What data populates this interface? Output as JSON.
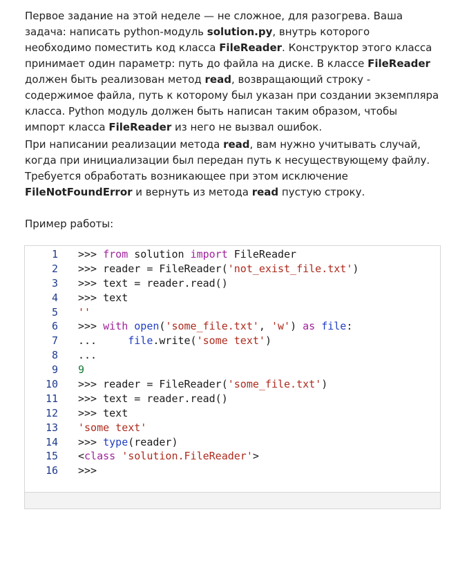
{
  "paragraph1": {
    "t1": "Первое задание на этой неделе — не сложное, для разогрева. Ваша задача: написать python-модуль ",
    "b1": "solution.py",
    "t2": ", внутрь которого необходимо поместить код класса ",
    "b2": "FileReader",
    "t3": ". Конструктор этого класса принимает один параметр: путь до файла на диске. В классе ",
    "b3": "FileReader",
    "t4": " должен быть реализован метод ",
    "b4": "read",
    "t5": ", возвращающий строку - содержимое файла, путь к которому был указан при создании экземпляра класса. Python модуль должен быть написан таким образом, чтобы импорт класса ",
    "b5": "FileReader",
    "t6": " из него не вызвал ошибок."
  },
  "paragraph2": {
    "t1": "При написании реализации метода ",
    "b1": "read",
    "t2": ", вам нужно учитывать случай, когда при инициализации был передан путь к несуществующему файлу. Требуется обработать возникающее при этом исключение ",
    "b2": "FileNotFoundError",
    "t3": " и вернуть из метода ",
    "b3": "read",
    "t4": " пустую строку."
  },
  "paragraph3": {
    "text": "Пример работы:"
  },
  "code_example": {
    "line_numbers": [
      "1",
      "2",
      "3",
      "4",
      "5",
      "6",
      "7",
      "8",
      "9",
      "10",
      "11",
      "12",
      "13",
      "14",
      "15",
      "16"
    ],
    "lines": [
      [
        {
          "t": ">>> "
        },
        {
          "t": "from",
          "c": "kw"
        },
        {
          "t": " solution "
        },
        {
          "t": "import",
          "c": "kw"
        },
        {
          "t": " FileReader"
        }
      ],
      [
        {
          "t": ">>> reader = FileReader("
        },
        {
          "t": "'not_exist_file.txt'",
          "c": "str"
        },
        {
          "t": ")"
        }
      ],
      [
        {
          "t": ">>> text = reader.read()"
        }
      ],
      [
        {
          "t": ">>> text"
        }
      ],
      [
        {
          "t": "''",
          "c": "str"
        }
      ],
      [
        {
          "t": ">>> "
        },
        {
          "t": "with",
          "c": "kw"
        },
        {
          "t": " "
        },
        {
          "t": "open",
          "c": "bi"
        },
        {
          "t": "("
        },
        {
          "t": "'some_file.txt'",
          "c": "str"
        },
        {
          "t": ", "
        },
        {
          "t": "'w'",
          "c": "str"
        },
        {
          "t": ") "
        },
        {
          "t": "as",
          "c": "kw"
        },
        {
          "t": " "
        },
        {
          "t": "file",
          "c": "bi"
        },
        {
          "t": ":"
        }
      ],
      [
        {
          "t": "...     "
        },
        {
          "t": "file",
          "c": "bi"
        },
        {
          "t": ".write("
        },
        {
          "t": "'some text'",
          "c": "str"
        },
        {
          "t": ")"
        }
      ],
      [
        {
          "t": "..."
        }
      ],
      [
        {
          "t": "9",
          "c": "num"
        }
      ],
      [
        {
          "t": ">>> reader = FileReader("
        },
        {
          "t": "'some_file.txt'",
          "c": "str"
        },
        {
          "t": ")"
        }
      ],
      [
        {
          "t": ">>> text = reader.read()"
        }
      ],
      [
        {
          "t": ">>> text"
        }
      ],
      [
        {
          "t": "'some text'",
          "c": "str"
        }
      ],
      [
        {
          "t": ">>> "
        },
        {
          "t": "type",
          "c": "bi"
        },
        {
          "t": "(reader)"
        }
      ],
      [
        {
          "t": "<"
        },
        {
          "t": "class",
          "c": "kw"
        },
        {
          "t": " "
        },
        {
          "t": "'solution.FileReader'",
          "c": "str"
        },
        {
          "t": ">"
        }
      ],
      [
        {
          "t": ">>>"
        }
      ]
    ]
  }
}
